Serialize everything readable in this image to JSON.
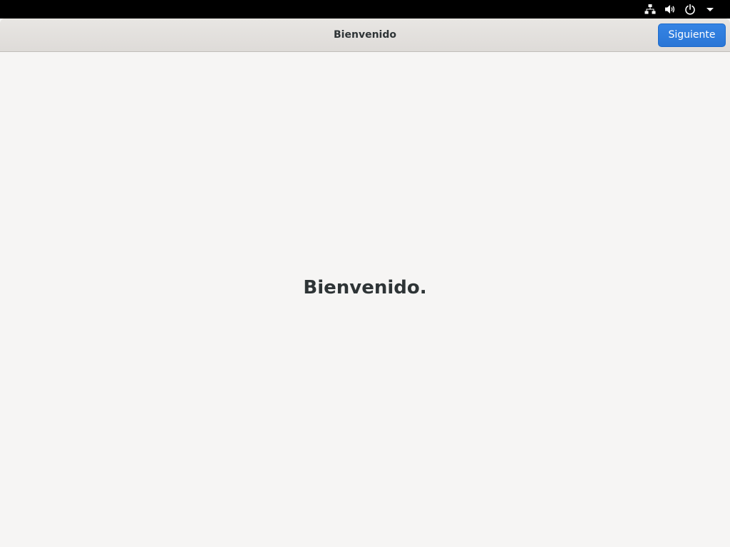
{
  "top_bar": {
    "icons": [
      "network-wired-icon",
      "speaker-volume-icon",
      "power-icon",
      "dropdown-arrow-icon"
    ]
  },
  "header": {
    "title": "Bienvenido",
    "next_label": "Siguiente"
  },
  "main": {
    "heading": "Bienvenido."
  },
  "colors": {
    "accent": "#3584e4",
    "background": "#f6f5f4",
    "topbar": "#000000",
    "text": "#2e3436"
  }
}
